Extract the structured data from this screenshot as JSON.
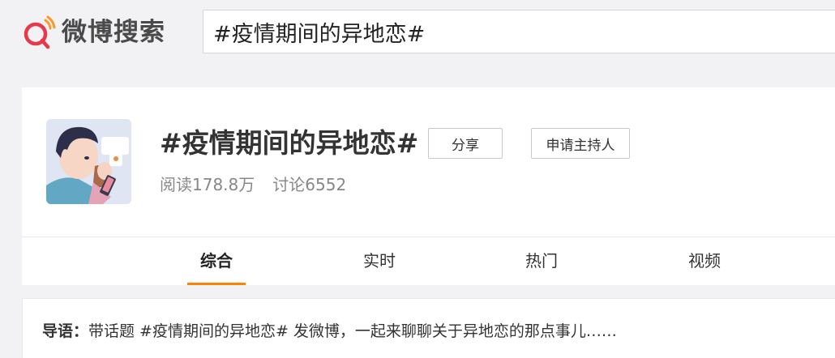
{
  "header": {
    "logo_text": "微博搜索",
    "logo_icon": "weibo-search-logo-icon",
    "search_value": "#疫情期间的异地恋#"
  },
  "topic": {
    "title": "#疫情期间的异地恋#",
    "share_label": "分享",
    "host_label": "申请主持人",
    "reads": "阅读178.8万",
    "discussions": "讨论6552"
  },
  "tabs": [
    {
      "label": "综合",
      "active": true
    },
    {
      "label": "实时",
      "active": false
    },
    {
      "label": "热门",
      "active": false
    },
    {
      "label": "视频",
      "active": false
    }
  ],
  "guide": {
    "label": "导语：",
    "text": "带话题 #疫情期间的异地恋# 发微博，一起来聊聊关于异地恋的那点事儿……"
  },
  "colors": {
    "accent": "#ff8200",
    "logo_orange": "#f59a2b",
    "logo_red": "#e6394a",
    "page_bg": "#f2f2f5"
  }
}
